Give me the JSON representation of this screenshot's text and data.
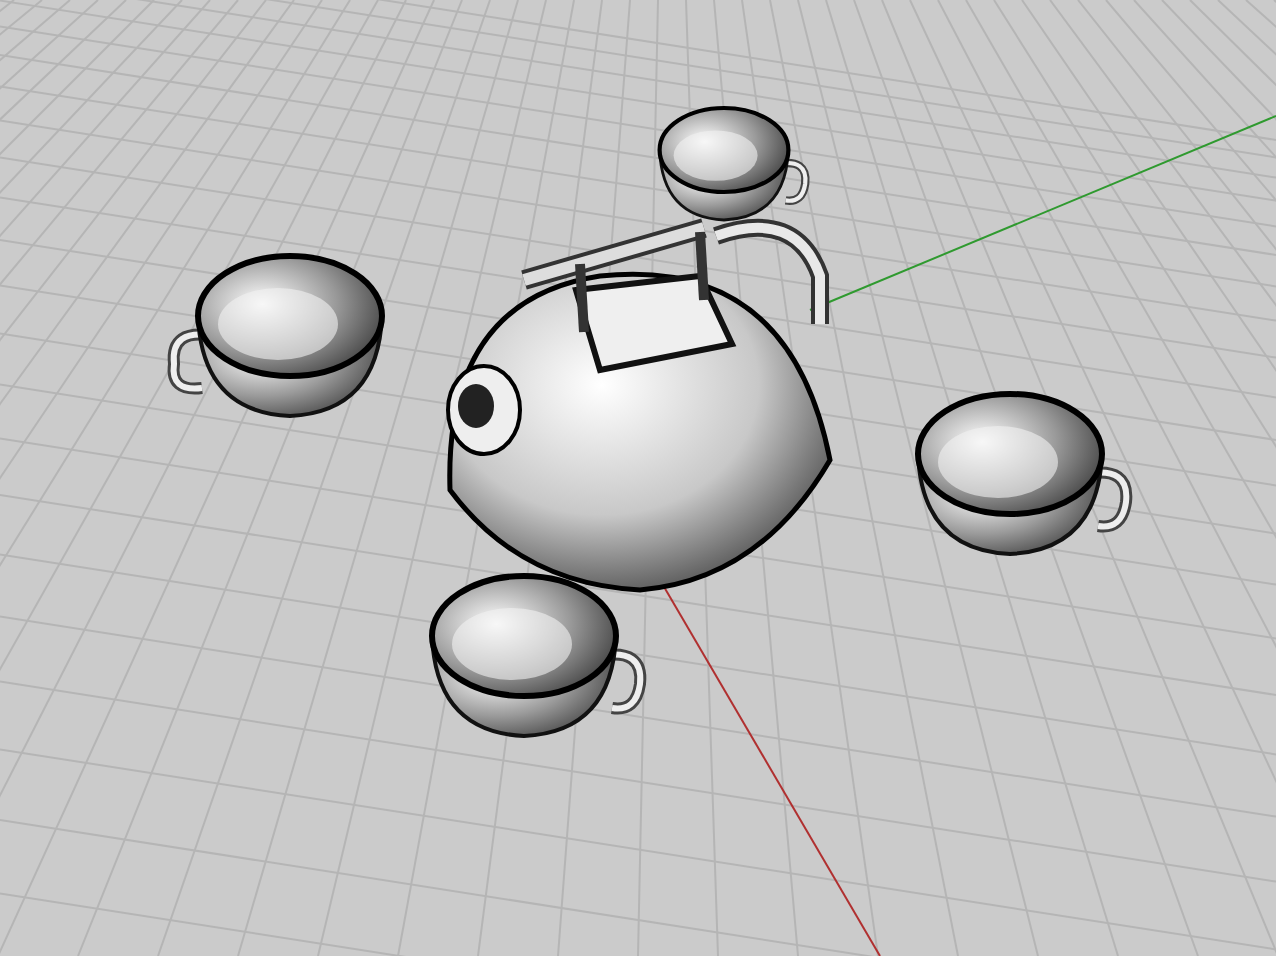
{
  "viewport": {
    "objects": [
      {
        "kind": "cup"
      },
      {
        "kind": "cup"
      },
      {
        "kind": "teapot"
      },
      {
        "kind": "cup"
      },
      {
        "kind": "cup"
      }
    ]
  }
}
